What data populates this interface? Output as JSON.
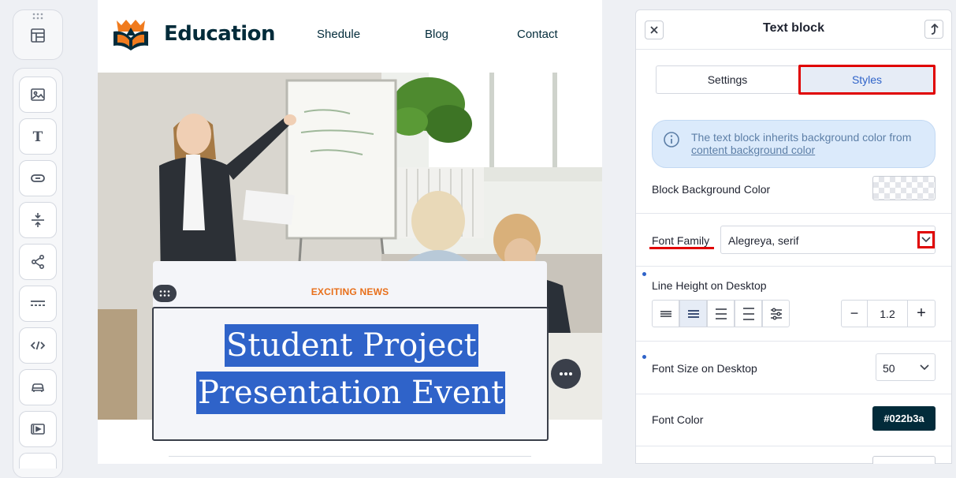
{
  "header": {
    "brand": "Education",
    "nav": [
      "Shedule",
      "Blog",
      "Contact"
    ]
  },
  "content_block": {
    "eyebrow": "EXCITING NEWS",
    "title_lines": [
      "Student Project",
      "Presentation Event"
    ]
  },
  "panel": {
    "title": "Text block",
    "tabs": {
      "settings": "Settings",
      "styles": "Styles",
      "active": "Styles"
    },
    "info": {
      "text": "The text block inherits background color from ",
      "link": "content background color"
    },
    "block_background_label": "Block Background Color",
    "font_family": {
      "label": "Font Family",
      "value": "Alegreya, serif"
    },
    "line_height": {
      "label": "Line Height on Desktop",
      "value": "1.2",
      "minus": "−",
      "plus": "+"
    },
    "font_size": {
      "label": "Font Size on Desktop",
      "value": "50"
    },
    "font_color": {
      "label": "Font Color",
      "value": "#022b3a"
    }
  },
  "colors": {
    "brand_dark": "#022b3a",
    "accent_orange": "#e86f1a",
    "selection_blue": "#2f63c9",
    "highlight_red": "#e00000"
  },
  "icons": {
    "rail": [
      "template-icon",
      "image-icon",
      "text-icon",
      "button-icon",
      "spacer-icon",
      "share-icon",
      "divider-icon",
      "html-icon",
      "menu-icon",
      "video-icon"
    ]
  }
}
